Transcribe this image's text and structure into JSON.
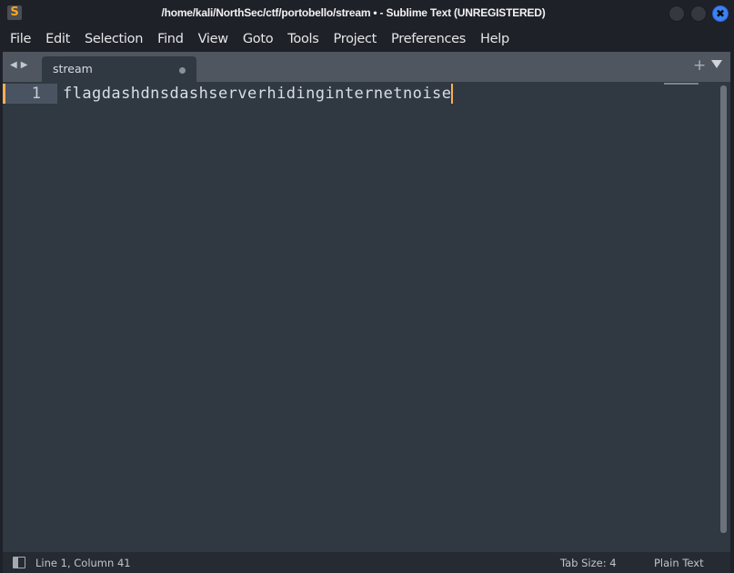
{
  "window": {
    "title": "/home/kali/NorthSec/ctf/portobello/stream • - Sublime Text (UNREGISTERED)",
    "app_icon_glyph": "S",
    "controls": {
      "minimize": "minimize-button",
      "maximize": "maximize-button",
      "close_glyph": "✖"
    },
    "colors": {
      "close_button": "#3b82f6",
      "accent": "#f9ae58",
      "icon": "#f5a623"
    }
  },
  "menu": {
    "items": [
      "File",
      "Edit",
      "Selection",
      "Find",
      "View",
      "Goto",
      "Tools",
      "Project",
      "Preferences",
      "Help"
    ]
  },
  "tabs": {
    "nav_back": "◀",
    "nav_forward": "▶",
    "items": [
      {
        "label": "stream",
        "dirty": true
      }
    ],
    "new_tab_glyph": "+",
    "menu_glyph": "dropdown-arrow"
  },
  "editor": {
    "lines": [
      {
        "number": "1",
        "text": "flagdashdnsdashserverhidinginternetnoise"
      }
    ]
  },
  "status": {
    "position": "Line 1, Column 41",
    "tab_size": "Tab Size: 4",
    "syntax": "Plain Text"
  }
}
